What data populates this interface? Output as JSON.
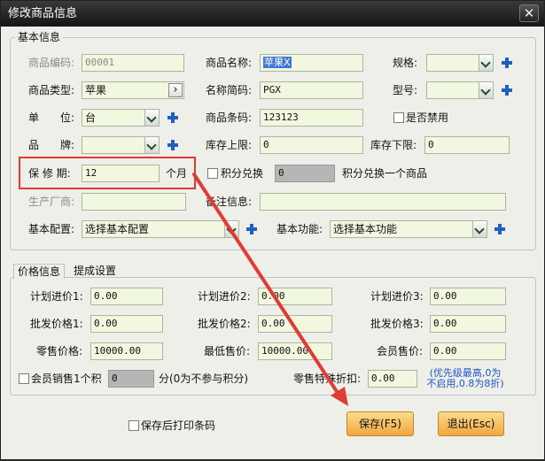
{
  "window": {
    "title": "修改商品信息",
    "close_glyph": "✕"
  },
  "basic": {
    "group_title": "基本信息",
    "code_label": "商品编码:",
    "code_value": "00001",
    "name_label": "商品名称:",
    "name_value": "苹果X",
    "spec_label": "规格:",
    "spec_value": "",
    "type_label": "商品类型:",
    "type_value": "苹果",
    "type_btn": "›",
    "short_label": "名称简码:",
    "short_value": "PGX",
    "model_label": "型号:",
    "model_value": "",
    "unit_label": "单　　位:",
    "unit_value": "台",
    "barcode_label": "商品条码:",
    "barcode_value": "123123",
    "disabled_label": "是否禁用",
    "brand_label": "品　　牌:",
    "brand_value": "",
    "stock_max_label": "库存上限:",
    "stock_max_value": "0",
    "stock_min_label": "库存下限:",
    "stock_min_value": "0",
    "warranty_label": "保 修 期:",
    "warranty_value": "12",
    "warranty_unit": "个月",
    "points_label": "积分兑换",
    "points_value": "0",
    "points_suffix": "积分兑换一个商品",
    "maker_label": "生产厂商:",
    "maker_value": "",
    "remark_label": "备注信息:",
    "remark_value": "",
    "config_label": "基本配置:",
    "config_value": "选择基本配置",
    "func_label": "基本功能:",
    "func_value": "选择基本功能"
  },
  "tabs": [
    "价格信息",
    "提成设置"
  ],
  "price": {
    "plan1_label": "计划进价1:",
    "plan1_value": "0.00",
    "plan2_label": "计划进价2:",
    "plan2_value": "0.00",
    "plan3_label": "计划进价3:",
    "plan3_value": "0.00",
    "whole1_label": "批发价格1:",
    "whole1_value": "0.00",
    "whole2_label": "批发价格2:",
    "whole2_value": "0.00",
    "whole3_label": "批发价格3:",
    "whole3_value": "0.00",
    "retail_label": "零售价格:",
    "retail_value": "10000.00",
    "min_label": "最低售价:",
    "min_value": "10000.00",
    "member_label": "会员售价:",
    "member_value": "0.00",
    "member_points_pre": "会员销售1个积",
    "member_points_value": "0",
    "member_points_suffix": "分(0为不参与积分)",
    "discount_label": "零售特殊折扣:",
    "discount_value": "0.00",
    "note_line1": "(优先级最高,0为",
    "note_line2": "不启用,0.8为8折)"
  },
  "footer": {
    "print_label": "保存后打印条码",
    "save_label": "保存(F5)",
    "exit_label": "退出(Esc)"
  },
  "colors": {
    "highlight_box": "#e03b34",
    "arrow": "#e03b34",
    "note_blue": "#1e55c4",
    "plus_blue": "#1f5fc4"
  }
}
